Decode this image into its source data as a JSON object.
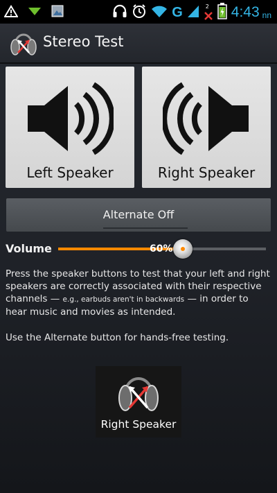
{
  "status_bar": {
    "network_type": "G",
    "sim_number": "2",
    "time": "4:43",
    "ampm": "nn",
    "icons": [
      "warning-icon",
      "download-icon",
      "image-icon",
      "headphones-icon",
      "alarm-icon",
      "wifi-icon",
      "signal-icon",
      "battery-icon"
    ],
    "accent_color": "#34b5e5"
  },
  "action_bar": {
    "title": "Stereo Test",
    "logo": "stereo-headphones-logo"
  },
  "speakers": {
    "left_label": "Left Speaker",
    "right_label": "Right Speaker"
  },
  "alternate": {
    "label": "Alternate Off"
  },
  "volume": {
    "label": "Volume",
    "percent_text": "60%",
    "level": 0.6,
    "accent_color": "#ff8a00"
  },
  "description": {
    "part1": "Press the speaker buttons to test that your left and right speakers are correctly associated with their respective channels — ",
    "small": "e.g., earbuds aren't in backwards",
    "part2": " — in order to hear music and movies as intended.",
    "alternate_hint": "Use the Alternate button for hands-free testing."
  },
  "widget": {
    "label": "Right Speaker"
  }
}
